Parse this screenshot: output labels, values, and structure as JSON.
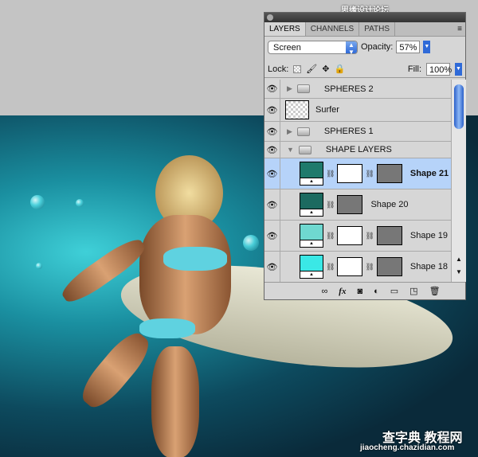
{
  "watermark_top": "思缘设计论坛 WWW.MISSYUAN.COM",
  "watermark_bottom": {
    "line1": "查字典 教程网",
    "line2": "jiaocheng.chazidian.com"
  },
  "panel": {
    "tabs": [
      {
        "label": "LAYERS"
      },
      {
        "label": "CHANNELS"
      },
      {
        "label": "PATHS"
      }
    ],
    "menu_icon": "≡",
    "blend_mode": "Screen",
    "opacity_label": "Opacity:",
    "opacity_value": "57%",
    "lock_label": "Lock:",
    "fill_label": "Fill:",
    "fill_value": "100%",
    "layers": [
      {
        "name": "SPHERES 2",
        "type": "group",
        "expanded": false
      },
      {
        "name": "Surfer",
        "type": "layer"
      },
      {
        "name": "SPHERES 1",
        "type": "group",
        "expanded": false
      },
      {
        "name": "SHAPE LAYERS",
        "type": "group",
        "expanded": true
      },
      {
        "name": "Shape 21",
        "type": "shape",
        "color": "#1f7a6c",
        "selected": true
      },
      {
        "name": "Shape 20",
        "type": "shape",
        "color": "#1c6a60"
      },
      {
        "name": "Shape 19",
        "type": "shape",
        "color": "#6fd8d0"
      },
      {
        "name": "Shape 18",
        "type": "shape",
        "color": "#3ae8e6"
      }
    ],
    "toolbar_icons": [
      "link-icon",
      "fx-icon",
      "mask-icon",
      "adjustment-icon",
      "folder-icon",
      "new-layer-icon",
      "trash-icon"
    ],
    "fx_label": "fx"
  }
}
